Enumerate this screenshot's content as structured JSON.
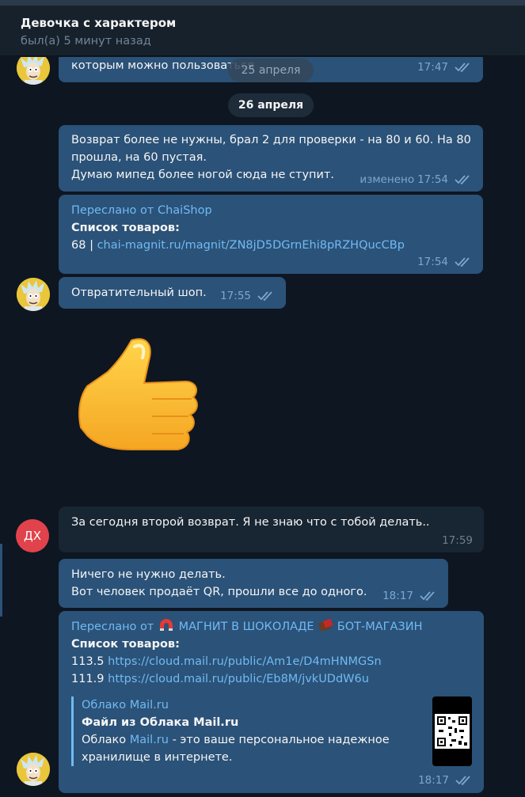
{
  "header": {
    "title": "Девочка с характером",
    "status": "был(а) 5 минут назад"
  },
  "dates": {
    "ghost": "25 апреля",
    "current": "26 апреля"
  },
  "messages": [
    {
      "text": "которым можно пользоваться",
      "time": "17:47"
    },
    {
      "lines": [
        "Возврат более не нужны, брал 2 для проверки - на 80 и 60. На 80",
        "прошла, на 60 пустая.",
        "Думаю мипед более ногой сюда не ступит."
      ],
      "edited": "изменено",
      "time": "17:54"
    },
    {
      "forwarded": "Переслано от ChaiShop",
      "heading": "Список товаров:",
      "num": "68",
      "sep": "|",
      "link": "chai-magnit.ru/magnit/ZN8jD5DGrnEhi8pRZHQucCBp",
      "time": "17:54"
    },
    {
      "text": "Отвратительный шоп.",
      "time": "17:55"
    },
    {
      "sticker": "thumbs-up"
    },
    {
      "avatar": "ДХ",
      "text": "За сегодня второй возврат. Я не знаю что с тобой делать..",
      "time": "17:59"
    },
    {
      "lines": [
        "Ничего не нужно делать.",
        "Вот человек продаёт QR, прошли все до одного."
      ],
      "time": "18:17"
    },
    {
      "forwarded_prefix": "Переслано от",
      "forwarded_from": "МАГНИТ В ШОКОЛАДЕ",
      "forwarded_suffix": "БОТ-МАГАЗИН",
      "heading": "Список товаров:",
      "items": [
        {
          "num": "113.5",
          "link": "https://cloud.mail.ru/public/Am1e/D4mHNMGSn"
        },
        {
          "num": "111.9",
          "link": "https://cloud.mail.ru/public/Eb8M/jvkUDdW6u"
        }
      ],
      "preview": {
        "site": "Облако Mail.ru",
        "title": "Файл из Облака Mail.ru",
        "desc_pre": "Облако ",
        "desc_link": "Mail.ru",
        "desc_post": " - это ваше персональное надежное",
        "desc_line2": "хранилище в интернете."
      },
      "time": "18:17"
    }
  ],
  "colors": {
    "background": "#0e1621",
    "outgoing": "#2b5278",
    "incoming": "#182533",
    "link": "#71baf4",
    "avatar_dx": "#e1434c"
  }
}
